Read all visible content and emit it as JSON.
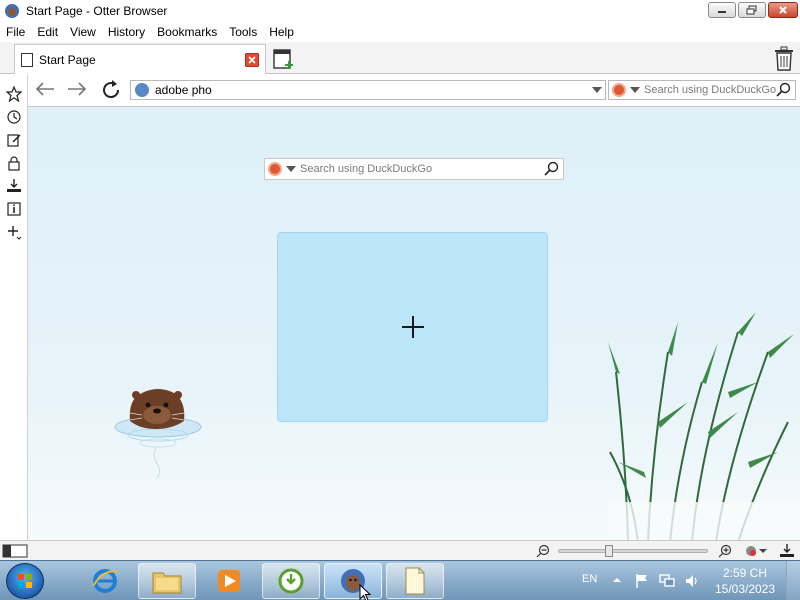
{
  "window": {
    "title": "Start Page - Otter Browser"
  },
  "menubar": {
    "items": [
      "File",
      "Edit",
      "View",
      "History",
      "Bookmarks",
      "Tools",
      "Help"
    ]
  },
  "tabs": [
    {
      "label": "Start Page"
    }
  ],
  "toolbar": {
    "address_value": "adobe pho",
    "search_placeholder": "Search using DuckDuckGo"
  },
  "start_page": {
    "search_placeholder": "Search using DuckDuckGo"
  },
  "sidebar": {
    "icons": [
      "star-icon",
      "history-icon",
      "notes-icon",
      "password-icon",
      "transfers-icon",
      "info-icon",
      "add-panel-icon"
    ]
  },
  "statusbar": {
    "zoom_level": 0.33
  },
  "taskbar": {
    "language": "EN",
    "time": "2:59 CH",
    "date": "15/03/2023"
  },
  "colors": {
    "accent": "#bce5fa",
    "close_red": "#e24a33",
    "duckduckgo": "#de5833"
  }
}
